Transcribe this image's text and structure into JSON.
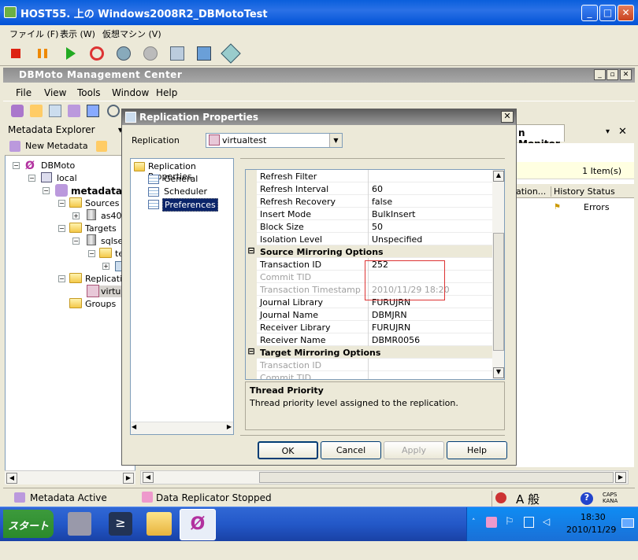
{
  "vm": {
    "title": "HOST55. 上の Windows2008R2_DBMotoTest",
    "menu": [
      "ファイル (F)",
      "表示 (W)",
      "仮想マシン (V)"
    ]
  },
  "app": {
    "title": "DBMoto Management Center",
    "menu": [
      "File",
      "View",
      "Tools",
      "Window",
      "Help"
    ]
  },
  "explorer": {
    "title": "Metadata Explorer",
    "pin": "▾ ⅎ",
    "new_metadata": "New Metadata",
    "tree": [
      "DBMoto",
      "local",
      "metadata",
      "Sources",
      "as400",
      "Targets",
      "sqlse",
      "te",
      "Replicatio",
      "virtua",
      "Groups"
    ]
  },
  "right_panel": {
    "tab": "n Monitor",
    "count": "1 Item(s)",
    "col1": "ation...",
    "col2": "History Status",
    "status": "Errors"
  },
  "status": {
    "left": "Metadata Active",
    "mid": "Data Replicator Stopped",
    "caps": "CAPS KANA"
  },
  "taskbar": {
    "start": "スタート",
    "time": "18:30",
    "date": "2010/11/29"
  },
  "dialog": {
    "title": "Replication Properties",
    "replication_label": "Replication",
    "replication_value": "virtualtest",
    "nav": [
      "Replication Properties",
      "General",
      "Scheduler",
      "Preferences"
    ],
    "rows": [
      {
        "k": "Refresh Filter",
        "v": "",
        "type": "prop"
      },
      {
        "k": "Refresh Interval",
        "v": "60",
        "type": "prop"
      },
      {
        "k": "Refresh Recovery",
        "v": "false",
        "type": "prop"
      },
      {
        "k": "Insert Mode",
        "v": "BulkInsert",
        "type": "prop"
      },
      {
        "k": "Block Size",
        "v": "50",
        "type": "prop"
      },
      {
        "k": "Isolation Level",
        "v": "Unspecified",
        "type": "prop"
      },
      {
        "k": "Source Mirroring Options",
        "v": "",
        "type": "cat"
      },
      {
        "k": "Transaction ID",
        "v": "252",
        "type": "prop"
      },
      {
        "k": "Commit TID",
        "v": "",
        "type": "dim"
      },
      {
        "k": "Transaction Timestamp",
        "v": "2010/11/29 18:20",
        "type": "dim"
      },
      {
        "k": "Journal Library",
        "v": "FURUJRN",
        "type": "prop"
      },
      {
        "k": "Journal Name",
        "v": "DBMJRN",
        "type": "prop"
      },
      {
        "k": "Receiver Library",
        "v": "FURUJRN",
        "type": "prop"
      },
      {
        "k": "Receiver Name",
        "v": "DBMR0056",
        "type": "prop"
      },
      {
        "k": "Target Mirroring Options",
        "v": "",
        "type": "cat"
      },
      {
        "k": "Transaction ID",
        "v": "",
        "type": "dim"
      },
      {
        "k": "Commit TID",
        "v": "",
        "type": "dim"
      }
    ],
    "desc_title": "Thread Priority",
    "desc_text": "Thread priority level assigned to the replication.",
    "buttons": {
      "ok": "OK",
      "cancel": "Cancel",
      "apply": "Apply",
      "help": "Help"
    }
  }
}
